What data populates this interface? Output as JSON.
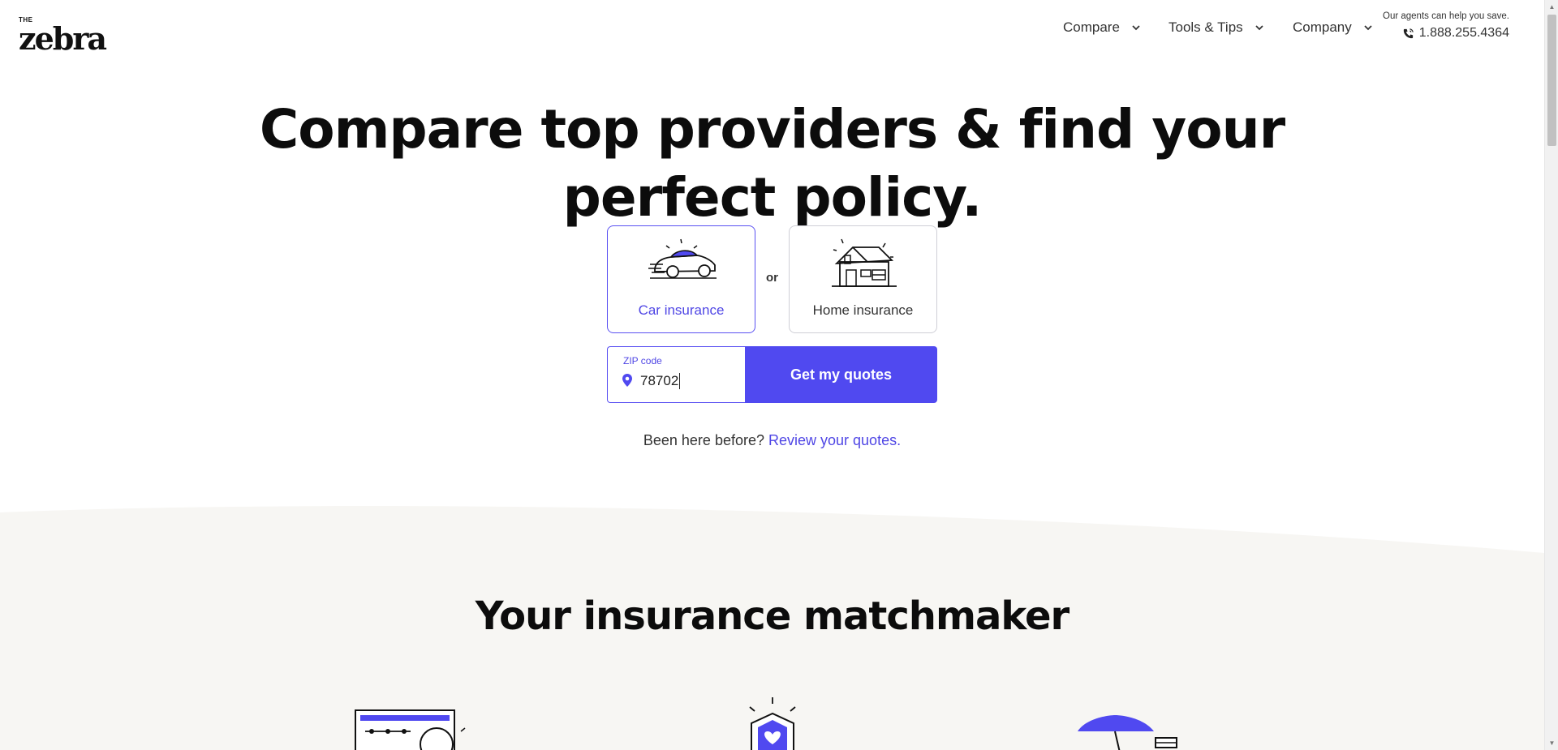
{
  "brand": {
    "the": "THE",
    "name": "zebra"
  },
  "nav": [
    {
      "label": "Compare"
    },
    {
      "label": "Tools & Tips"
    },
    {
      "label": "Company"
    }
  ],
  "contact": {
    "note": "Our agents can help you save.",
    "phone": "1.888.255.4364"
  },
  "hero": {
    "title_line1": "Compare top providers & find your",
    "title_line2": "perfect policy."
  },
  "products": [
    {
      "label": "Car insurance",
      "selected": true,
      "icon": "car-icon"
    },
    {
      "label": "Home insurance",
      "selected": false,
      "icon": "house-icon"
    }
  ],
  "or_label": "or",
  "zip": {
    "label": "ZIP code",
    "value": "78702"
  },
  "cta_label": "Get my quotes",
  "returning": {
    "prefix": "Been here before? ",
    "link": "Review your quotes",
    "suffix": "."
  },
  "section": {
    "title": "Your insurance matchmaker"
  },
  "colors": {
    "accent": "#5049f0",
    "section_bg": "#f7f6f3"
  }
}
